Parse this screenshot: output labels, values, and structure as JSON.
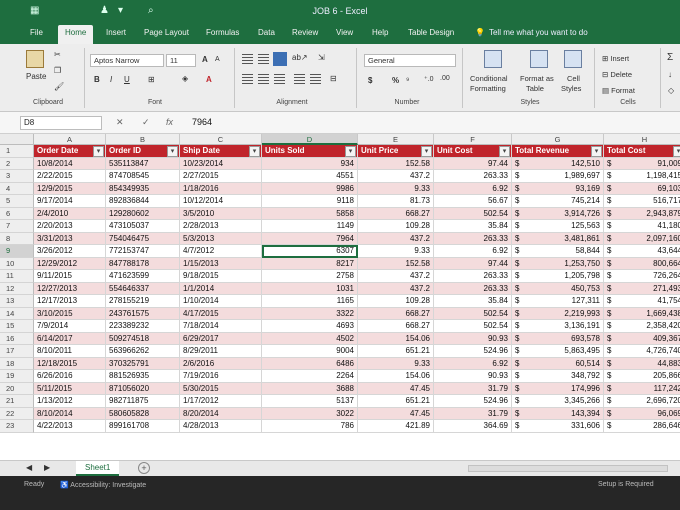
{
  "titlebar": {
    "title": "JOB 6  -  Excel"
  },
  "tabs": [
    "File",
    "Home",
    "Insert",
    "Page Layout",
    "Formulas",
    "Data",
    "Review",
    "View",
    "Help",
    "Table Design"
  ],
  "active_tab": "Home",
  "tell_me": "Tell me what you want to do",
  "ribbon": {
    "clipboard": {
      "paste": "Paste",
      "label": "Clipboard"
    },
    "font": {
      "name": "Aptos Narrow",
      "size": "11",
      "bold": "B",
      "italic": "I",
      "underline": "U",
      "grow": "A",
      "shrink": "A",
      "color_a": "A",
      "label": "Font"
    },
    "alignment": {
      "label": "Alignment"
    },
    "number": {
      "format": "General",
      "currency": "$",
      "percent": "%",
      "label": "Number"
    },
    "styles": {
      "conditional": "Conditional",
      "conditional2": "Formatting",
      "format_as": "Format as",
      "format_as2": "Table",
      "cell": "Cell",
      "cell2": "Styles",
      "label": "Styles"
    },
    "cells": {
      "insert": "Insert",
      "delete": "Delete",
      "format": "Format",
      "label": "Cells"
    },
    "editing": {
      "sigma": "Σ"
    }
  },
  "formula_bar": {
    "name_box": "D8",
    "cancel": "✕",
    "enter": "✓",
    "fx": "fx",
    "value": "7964"
  },
  "columns": [
    "A",
    "B",
    "C",
    "D",
    "E",
    "F",
    "G",
    "H"
  ],
  "selected_column": "D",
  "table": {
    "headers": [
      "Order Date",
      "Order ID",
      "Ship Date",
      "Units Sold",
      "Unit Price",
      "Unit Cost",
      "Total Revenue",
      "Total Cost"
    ],
    "rows": [
      [
        "10/8/2014",
        "535113847",
        "10/23/2014",
        "934",
        "152.58",
        "97.44",
        "142,510",
        "91,009"
      ],
      [
        "2/22/2015",
        "874708545",
        "2/27/2015",
        "4551",
        "437.2",
        "263.33",
        "1,989,697",
        "1,198,415"
      ],
      [
        "12/9/2015",
        "854349935",
        "1/18/2016",
        "9986",
        "9.33",
        "6.92",
        "93,169",
        "69,103"
      ],
      [
        "9/17/2014",
        "892836844",
        "10/12/2014",
        "9118",
        "81.73",
        "56.67",
        "745,214",
        "516,717"
      ],
      [
        "2/4/2010",
        "129280602",
        "3/5/2010",
        "5858",
        "668.27",
        "502.54",
        "3,914,726",
        "2,943,879"
      ],
      [
        "2/20/2013",
        "473105037",
        "2/28/2013",
        "1149",
        "109.28",
        "35.84",
        "125,563",
        "41,180"
      ],
      [
        "3/31/2013",
        "754046475",
        "5/3/2013",
        "7964",
        "437.2",
        "263.33",
        "3,481,861",
        "2,097,160"
      ],
      [
        "3/26/2012",
        "772153747",
        "4/7/2012",
        "6307",
        "9.33",
        "6.92",
        "58,844",
        "43,644"
      ],
      [
        "12/29/2012",
        "847788178",
        "1/15/2013",
        "8217",
        "152.58",
        "97.44",
        "1,253,750",
        "800,664"
      ],
      [
        "9/11/2015",
        "471623599",
        "9/18/2015",
        "2758",
        "437.2",
        "263.33",
        "1,205,798",
        "726,264"
      ],
      [
        "12/27/2013",
        "554646337",
        "1/1/2014",
        "1031",
        "437.2",
        "263.33",
        "450,753",
        "271,493"
      ],
      [
        "12/17/2013",
        "278155219",
        "1/10/2014",
        "1165",
        "109.28",
        "35.84",
        "127,311",
        "41,754"
      ],
      [
        "3/10/2015",
        "243761575",
        "4/17/2015",
        "3322",
        "668.27",
        "502.54",
        "2,219,993",
        "1,669,438"
      ],
      [
        "7/9/2014",
        "223389232",
        "7/18/2014",
        "4693",
        "668.27",
        "502.54",
        "3,136,191",
        "2,358,420"
      ],
      [
        "6/14/2017",
        "509274518",
        "6/29/2017",
        "4502",
        "154.06",
        "90.93",
        "693,578",
        "409,367"
      ],
      [
        "8/10/2011",
        "563966262",
        "8/29/2011",
        "9004",
        "651.21",
        "524.96",
        "5,863,495",
        "4,726,740"
      ],
      [
        "12/18/2015",
        "370325791",
        "2/6/2016",
        "6486",
        "9.33",
        "6.92",
        "60,514",
        "44,883"
      ],
      [
        "6/26/2016",
        "881526935",
        "7/19/2016",
        "2264",
        "154.06",
        "90.93",
        "348,792",
        "205,866"
      ],
      [
        "5/11/2015",
        "871056020",
        "5/30/2015",
        "3688",
        "47.45",
        "31.79",
        "174,996",
        "117,242"
      ],
      [
        "1/13/2012",
        "982711875",
        "1/17/2012",
        "5137",
        "651.21",
        "524.96",
        "3,345,266",
        "2,696,720"
      ],
      [
        "8/10/2014",
        "580605828",
        "8/20/2014",
        "3022",
        "47.45",
        "31.79",
        "143,394",
        "96,069"
      ],
      [
        "4/22/2013",
        "899161708",
        "4/28/2013",
        "786",
        "421.89",
        "364.69",
        "331,606",
        "286,646"
      ]
    ],
    "currency_symbol": "$",
    "active_cell": {
      "row": 7,
      "col": 3
    }
  },
  "sheet_tabs": [
    "Sheet1"
  ],
  "status": {
    "ready": "Ready",
    "accessibility": "Accessibility: Investigate",
    "right": "Setup is Required"
  },
  "colors": {
    "excel_green": "#1e6e3f",
    "header_red": "#c0242b",
    "band_pink": "#f4dcdd"
  }
}
